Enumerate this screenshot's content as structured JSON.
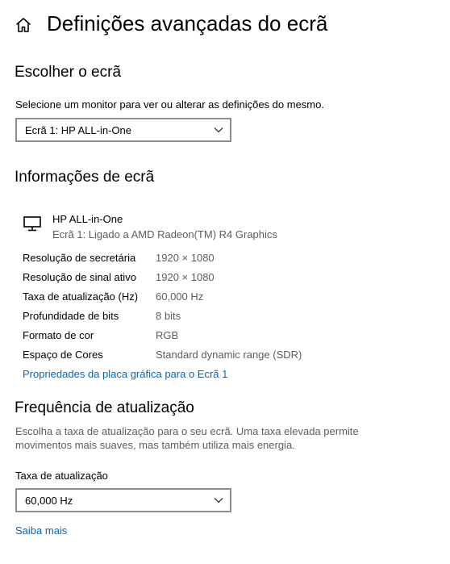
{
  "header": {
    "title": "Definições avançadas do ecrã"
  },
  "choose_display": {
    "heading": "Escolher o ecrã",
    "description": "Selecione um monitor para ver ou alterar as definições do mesmo.",
    "selected_display": "Ecrã 1: HP ALL-in-One"
  },
  "display_info": {
    "heading": "Informações de ecrã",
    "monitor_name": "HP ALL-in-One",
    "monitor_subtitle": "Ecrã 1: Ligado a AMD Radeon(TM) R4 Graphics",
    "rows": [
      {
        "key": "Resolução de secretária",
        "value": "1920 × 1080"
      },
      {
        "key": "Resolução de sinal ativo",
        "value": "1920 × 1080"
      },
      {
        "key": "Taxa de atualização (Hz)",
        "value": "60,000 Hz"
      },
      {
        "key": "Profundidade de bits",
        "value": "8 bits"
      },
      {
        "key": "Formato de cor",
        "value": "RGB"
      },
      {
        "key": "Espaço de Cores",
        "value": "Standard dynamic range (SDR)"
      }
    ],
    "adapter_link": "Propriedades da placa gráfica para o Ecrã 1"
  },
  "refresh": {
    "heading": "Frequência de atualização",
    "description_line1": "Escolha a taxa de atualização para o seu ecrã. Uma taxa elevada permite",
    "description_line2": "movimentos mais suaves, mas também utiliza mais energia.",
    "field_label": "Taxa de atualização",
    "selected_rate": "60,000 Hz",
    "learn_more": "Saiba mais"
  },
  "icons": {
    "home": "home-icon",
    "monitor": "monitor-icon",
    "chevron": "chevron-down-icon"
  }
}
